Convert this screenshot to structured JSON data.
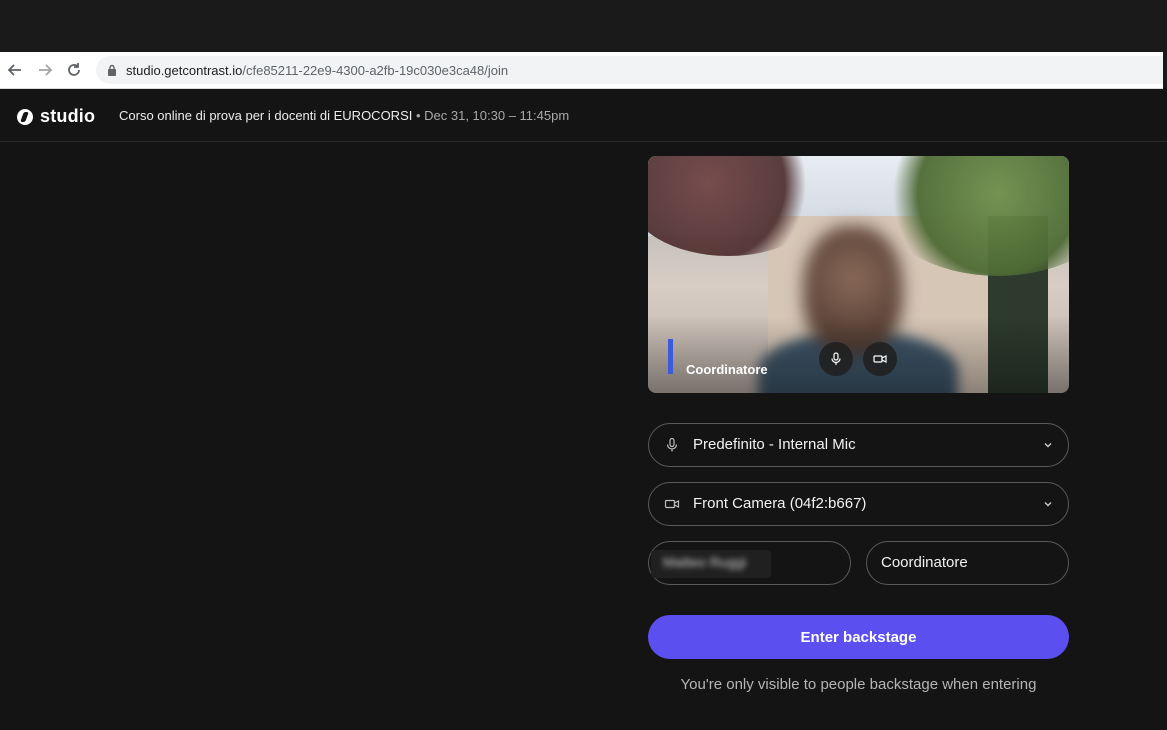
{
  "browser": {
    "url_host": "studio.getcontrast.io",
    "url_path": "/cfe85211-22e9-4300-a2fb-19c030e3ca48/join"
  },
  "app": {
    "logo_text": "studio",
    "event_title": "Corso online di prova per i docenti di EUROCORSI",
    "event_date": " • Dec 31, 10:30 – 11:45pm"
  },
  "preview": {
    "participant_label": "Coordinatore"
  },
  "devices": {
    "mic_label": "Predefinito - Internal Mic",
    "camera_label": "Front Camera (04f2:b667)"
  },
  "form": {
    "name_value": "Matteo Ruggi",
    "role_value": "Coordinatore"
  },
  "actions": {
    "enter_label": "Enter backstage",
    "note": "You're only visible to people backstage when entering"
  },
  "colors": {
    "accent": "#5b4ff0",
    "name_bar": "#3b5bdb",
    "background": "#141414"
  }
}
